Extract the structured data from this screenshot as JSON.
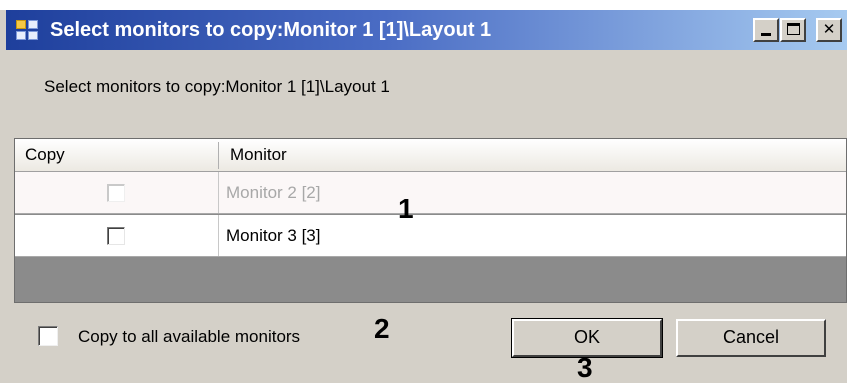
{
  "window": {
    "title": "Select monitors to copy:Monitor 1 [1]\\Layout 1",
    "controls": {
      "minimize": "_",
      "maximize": "□",
      "close": "✕"
    }
  },
  "prompt": "Select monitors to copy:Monitor 1 [1]\\Layout 1",
  "grid": {
    "columns": [
      "Copy",
      "Monitor"
    ],
    "rows": [
      {
        "monitor": "Monitor 2 [2]",
        "checked": false,
        "enabled": false
      },
      {
        "monitor": "Monitor 3 [3]",
        "checked": false,
        "enabled": true
      }
    ]
  },
  "copy_all": {
    "label": "Copy to all available monitors",
    "checked": false
  },
  "buttons": {
    "ok": "OK",
    "cancel": "Cancel"
  },
  "callouts": [
    "1",
    "2",
    "3"
  ],
  "colors": {
    "titlebar_start": "#1e3f9c",
    "titlebar_end": "#a6caf0",
    "window_bg": "#d4d0c8",
    "grid_empty_bg": "#8b8b8b",
    "disabled_text": "#a8a8a8"
  },
  "icons": {
    "app": "window-grid-icon",
    "minimize": "minimize-icon",
    "maximize": "maximize-icon",
    "close": "close-icon"
  }
}
